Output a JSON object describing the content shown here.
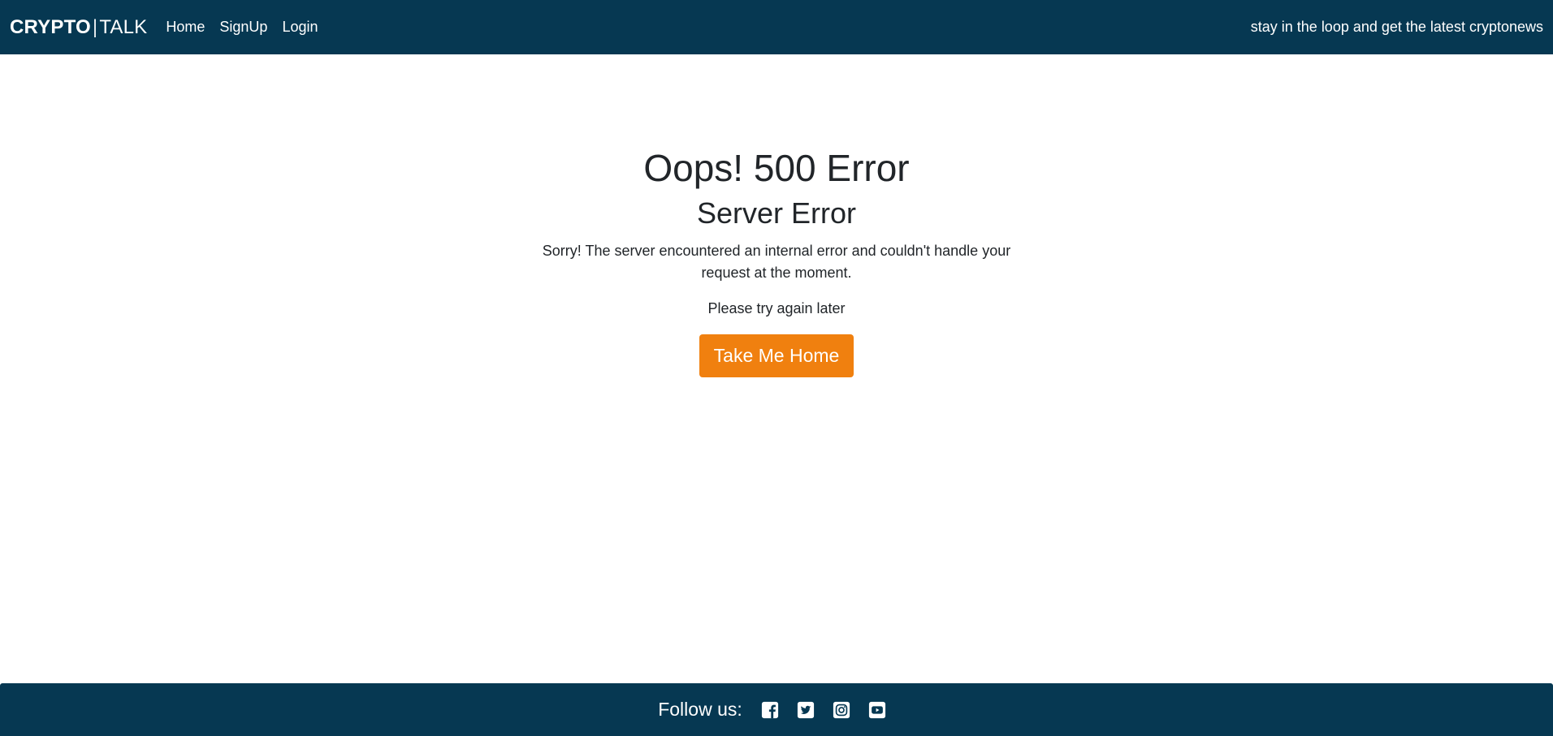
{
  "navbar": {
    "brand_strong": "CRYPTO",
    "brand_sep": "|",
    "brand_light": "TALK",
    "links": [
      "Home",
      "SignUp",
      "Login"
    ],
    "tagline": "stay in the loop and get the latest cryptonews"
  },
  "main": {
    "title": "Oops! 500 Error",
    "subtitle": "Server Error",
    "message": "Sorry! The server encountered an internal error and couldn't handle your request at the moment.",
    "hint": "Please try again later",
    "button_label": "Take Me Home"
  },
  "footer": {
    "follow_label": "Follow us:",
    "social_icons": [
      "facebook-icon",
      "twitter-icon",
      "instagram-icon",
      "youtube-icon"
    ]
  },
  "colors": {
    "navbar_bg": "#063852",
    "accent_button": "#f0800f",
    "text_dark": "#212529",
    "text_light": "#ffffff"
  }
}
